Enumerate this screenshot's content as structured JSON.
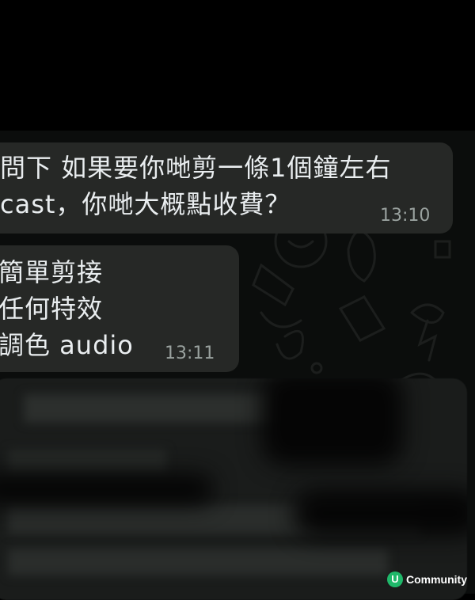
{
  "chat": {
    "messages": [
      {
        "lines": [
          "問下 如果要你哋剪一條1個鐘左右",
          "cast，你哋大概點收費？"
        ],
        "time": "13:10"
      },
      {
        "lines": [
          "簡單剪接",
          "任何特效",
          "調色 audio"
        ],
        "time": "13:11"
      }
    ]
  },
  "watermark": {
    "logo": "U",
    "text": "Community"
  },
  "colors": {
    "bubble": "#262826",
    "background": "#0b0d0c",
    "brand": "#1fb86a"
  }
}
